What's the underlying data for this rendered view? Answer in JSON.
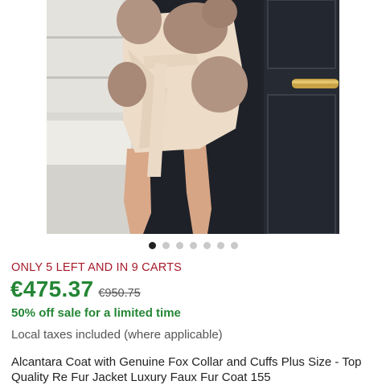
{
  "product": {
    "image_alt": "Woman wearing a beige coat with fur collar and cuffs next to a black door",
    "carousel": {
      "total": 7,
      "active": 1
    },
    "stock_notice": "ONLY 5 LEFT AND IN 9 CARTS",
    "price": "€475.37",
    "original_price": "€950.75",
    "sale_text": "50% off sale for a limited time",
    "tax_note": "Local taxes included (where applicable)",
    "title": "Alcantara Coat with Genuine Fox Collar and Cuffs Plus Size - Top Quality Re Fur Jacket Luxury Faux Fur Coat 155"
  },
  "colors": {
    "stock_red": "#a61a2a",
    "price_green": "#258635",
    "door_black": "#1e2128",
    "coat_beige": "#ecdcc8",
    "fur_brown": "#a88876"
  }
}
